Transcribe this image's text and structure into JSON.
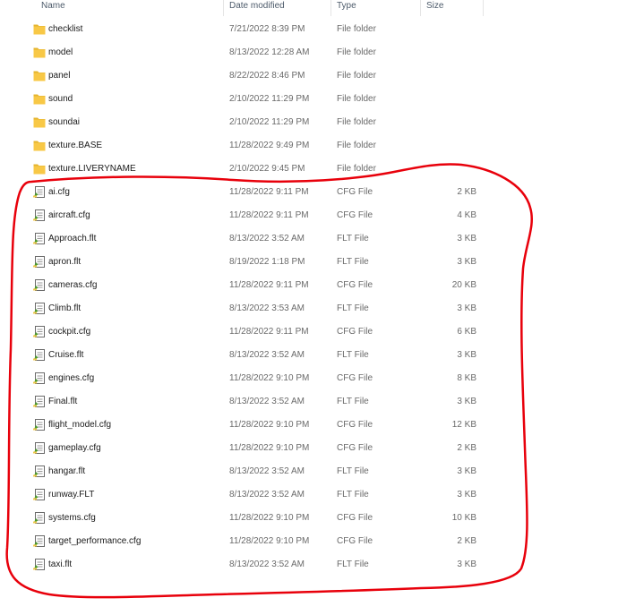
{
  "columns": {
    "name": "Name",
    "date": "Date modified",
    "type": "Type",
    "size": "Size"
  },
  "files": [
    {
      "name": "checklist",
      "date": "7/21/2022 8:39 PM",
      "type": "File folder",
      "size": "",
      "icon": "folder-icon"
    },
    {
      "name": "model",
      "date": "8/13/2022 12:28 AM",
      "type": "File folder",
      "size": "",
      "icon": "folder-icon"
    },
    {
      "name": "panel",
      "date": "8/22/2022 8:46 PM",
      "type": "File folder",
      "size": "",
      "icon": "folder-icon"
    },
    {
      "name": "sound",
      "date": "2/10/2022 11:29 PM",
      "type": "File folder",
      "size": "",
      "icon": "folder-icon"
    },
    {
      "name": "soundai",
      "date": "2/10/2022 11:29 PM",
      "type": "File folder",
      "size": "",
      "icon": "folder-icon"
    },
    {
      "name": "texture.BASE",
      "date": "11/28/2022 9:49 PM",
      "type": "File folder",
      "size": "",
      "icon": "folder-icon"
    },
    {
      "name": "texture.LIVERYNAME",
      "date": "2/10/2022 9:45 PM",
      "type": "File folder",
      "size": "",
      "icon": "folder-icon"
    },
    {
      "name": "ai.cfg",
      "date": "11/28/2022 9:11 PM",
      "type": "CFG File",
      "size": "2 KB",
      "icon": "config-file-icon"
    },
    {
      "name": "aircraft.cfg",
      "date": "11/28/2022 9:11 PM",
      "type": "CFG File",
      "size": "4 KB",
      "icon": "config-file-icon"
    },
    {
      "name": "Approach.flt",
      "date": "8/13/2022 3:52 AM",
      "type": "FLT File",
      "size": "3 KB",
      "icon": "config-file-icon"
    },
    {
      "name": "apron.flt",
      "date": "8/19/2022 1:18 PM",
      "type": "FLT File",
      "size": "3 KB",
      "icon": "config-file-icon"
    },
    {
      "name": "cameras.cfg",
      "date": "11/28/2022 9:11 PM",
      "type": "CFG File",
      "size": "20 KB",
      "icon": "config-file-icon"
    },
    {
      "name": "Climb.flt",
      "date": "8/13/2022 3:53 AM",
      "type": "FLT File",
      "size": "3 KB",
      "icon": "config-file-icon"
    },
    {
      "name": "cockpit.cfg",
      "date": "11/28/2022 9:11 PM",
      "type": "CFG File",
      "size": "6 KB",
      "icon": "config-file-icon"
    },
    {
      "name": "Cruise.flt",
      "date": "8/13/2022 3:52 AM",
      "type": "FLT File",
      "size": "3 KB",
      "icon": "config-file-icon"
    },
    {
      "name": "engines.cfg",
      "date": "11/28/2022 9:10 PM",
      "type": "CFG File",
      "size": "8 KB",
      "icon": "config-file-icon"
    },
    {
      "name": "Final.flt",
      "date": "8/13/2022 3:52 AM",
      "type": "FLT File",
      "size": "3 KB",
      "icon": "config-file-icon"
    },
    {
      "name": "flight_model.cfg",
      "date": "11/28/2022 9:10 PM",
      "type": "CFG File",
      "size": "12 KB",
      "icon": "config-file-icon"
    },
    {
      "name": "gameplay.cfg",
      "date": "11/28/2022 9:10 PM",
      "type": "CFG File",
      "size": "2 KB",
      "icon": "config-file-icon"
    },
    {
      "name": "hangar.flt",
      "date": "8/13/2022 3:52 AM",
      "type": "FLT File",
      "size": "3 KB",
      "icon": "config-file-icon"
    },
    {
      "name": "runway.FLT",
      "date": "8/13/2022 3:52 AM",
      "type": "FLT File",
      "size": "3 KB",
      "icon": "config-file-icon"
    },
    {
      "name": "systems.cfg",
      "date": "11/28/2022 9:10 PM",
      "type": "CFG File",
      "size": "10 KB",
      "icon": "config-file-icon"
    },
    {
      "name": "target_performance.cfg",
      "date": "11/28/2022 9:10 PM",
      "type": "CFG File",
      "size": "2 KB",
      "icon": "config-file-icon"
    },
    {
      "name": "taxi.flt",
      "date": "8/13/2022 3:52 AM",
      "type": "FLT File",
      "size": "3 KB",
      "icon": "config-file-icon"
    }
  ],
  "colors": {
    "annotation": "#e8000b",
    "folder": "#f8c846",
    "file_accent": "#4a9a2e"
  }
}
